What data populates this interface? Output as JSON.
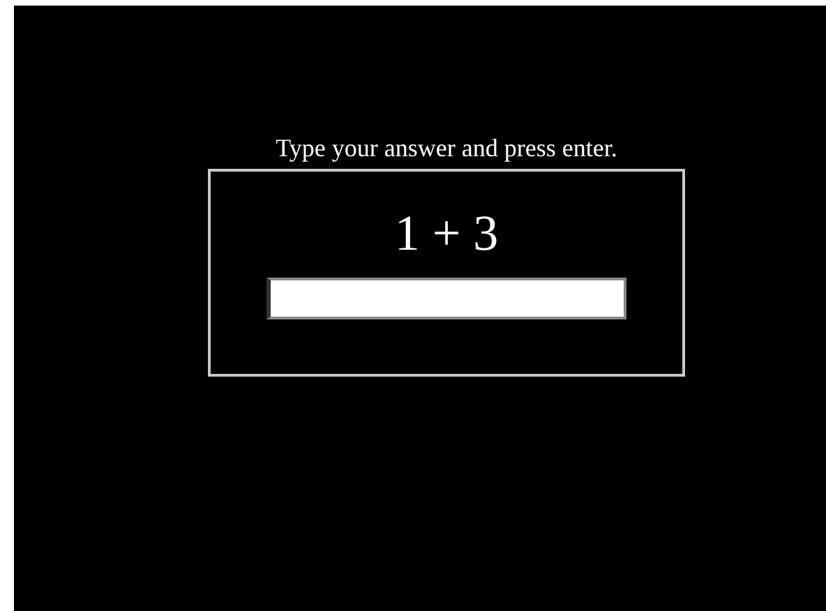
{
  "prompt": "Type your answer and press enter.",
  "question": "1 + 3"
}
